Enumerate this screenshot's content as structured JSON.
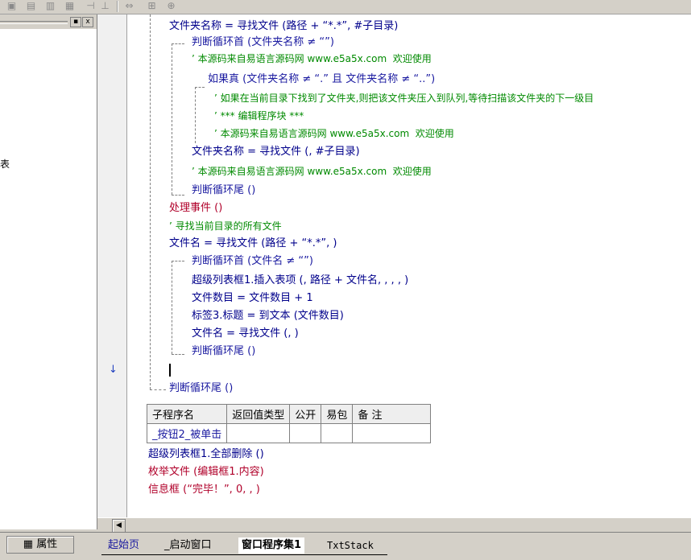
{
  "toolbar": {
    "icons": [
      "grid-icon",
      "table-icon",
      "columns-icon",
      "split-icon",
      "align-icon",
      "align2-icon",
      "resize-icon",
      "expand-icon",
      "fit-icon"
    ]
  },
  "left_panel": {
    "min_button": "▪",
    "close_button": "x",
    "fragment_text": "表"
  },
  "gutter": {
    "current_marker": "»",
    "bookmark_marker": "↓"
  },
  "code": [
    [
      "文件夹名称 = 寻找文件 (路径 + “*.*”, #子目录)"
    ],
    [
      "判断循环首 (文件夹名称 ≠ “”)"
    ],
    [
      "’ 本源码来自易语言源码网 www.e5a5x.com  欢迎使用"
    ],
    [
      "如果真 (文件夹名称 ≠ “.” 且 文件夹名称 ≠ “..”)"
    ],
    [
      "’ 如果在当前目录下找到了文件夹,则把该文件夹压入到队列,等待扫描该文件夹的下一级目"
    ],
    [
      "’ *** 编辑程序块 ***"
    ],
    [
      "’ 本源码来自易语言源码网 www.e5a5x.com  欢迎使用"
    ],
    [
      "文件夹名称 = 寻找文件 (, #子目录)"
    ],
    [
      "’ 本源码来自易语言源码网 www.e5a5x.com  欢迎使用"
    ],
    [
      "判断循环尾 ()"
    ],
    [
      "处理事件 ()"
    ],
    [
      "’ 寻找当前目录的所有文件"
    ],
    [
      "文件名 = 寻找文件 (路径 + “*.*”, )"
    ],
    [
      "判断循环首 (文件名 ≠ “”)"
    ],
    [
      "超级列表框1.插入表项 (, 路径 + 文件名, , , , )"
    ],
    [
      "文件数目 = 文件数目 + 1"
    ],
    [
      "标签3.标题 = 到文本 (文件数目)"
    ],
    [
      "文件名 = 寻找文件 (, )"
    ],
    [
      "判断循环尾 ()"
    ],
    [
      "判断循环尾 ()"
    ]
  ],
  "sub_table": {
    "headers": [
      "子程序名",
      "返回值类型",
      "公开",
      "易包",
      "备 注"
    ],
    "row": [
      "_按钮2_被单击",
      "",
      "",
      "",
      ""
    ]
  },
  "sub_body": [
    "超级列表框1.全部删除 ()",
    "枚举文件 (编辑框1.内容)",
    "信息框 (“完毕！”, 0, , )"
  ],
  "scroll": {
    "left_arrow": "◀"
  },
  "bottom": {
    "properties_button": "属性",
    "tabs": [
      "起始页",
      "_启动窗口",
      "窗口程序集1",
      "TxtStack"
    ]
  }
}
